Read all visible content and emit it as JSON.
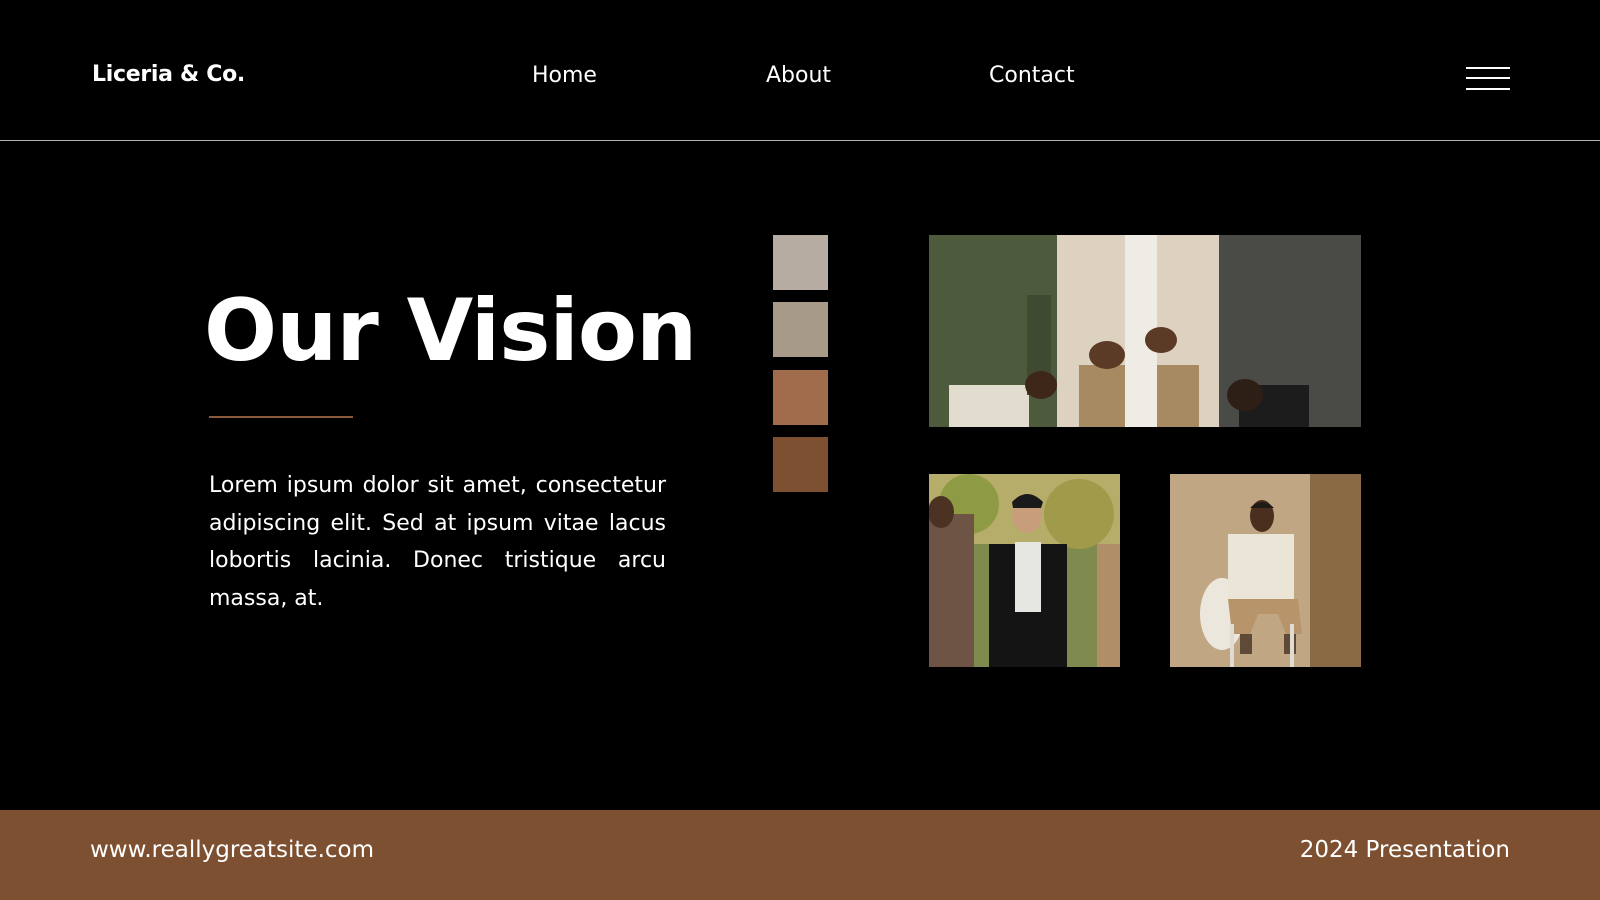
{
  "header": {
    "brand": "Liceria & Co.",
    "nav": {
      "home": "Home",
      "about": "About",
      "contact": "Contact"
    },
    "menu_icon": "hamburger-menu-icon"
  },
  "main": {
    "title": "Our Vision",
    "body": "Lorem ipsum dolor sit amet, consectetur adipiscing elit. Sed at ipsum vitae lacus lobortis lacinia. Donec tristique arcu massa, at."
  },
  "palette": {
    "swatches": [
      "#b7aca2",
      "#a79a88",
      "#a06c4b",
      "#7c5030"
    ]
  },
  "footer": {
    "url": "www.reallygreatsite.com",
    "label": "2024 Presentation"
  },
  "colors": {
    "background": "#000000",
    "accent": "#7c5030",
    "text": "#ffffff"
  }
}
